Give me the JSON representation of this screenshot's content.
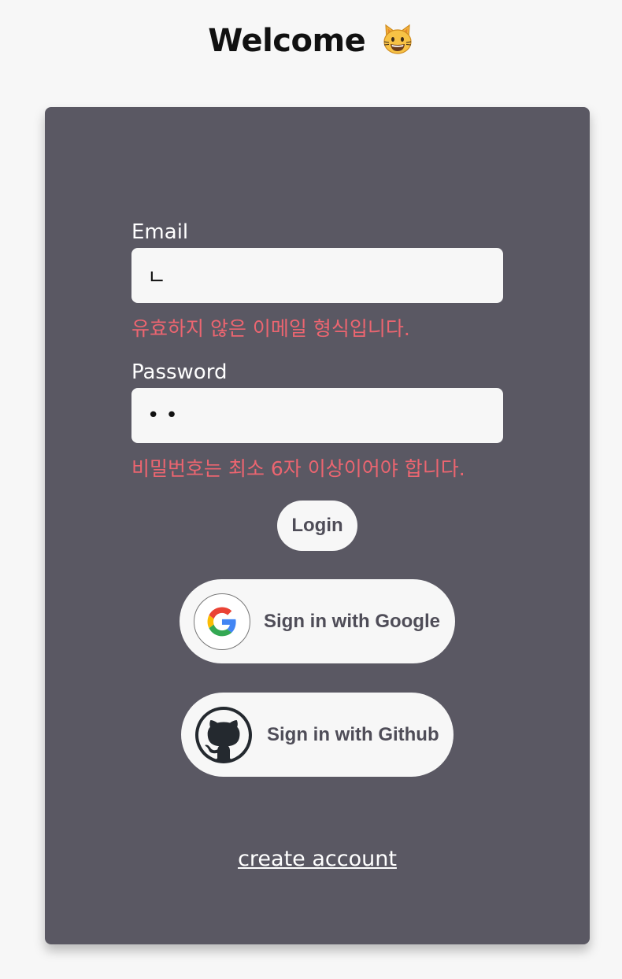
{
  "header": {
    "title": "Welcome",
    "emoji_icon": "grinning-cat-emoji"
  },
  "form": {
    "email": {
      "label": "Email",
      "value": "ㄴ",
      "error": "유효하지 않은 이메일 형식입니다."
    },
    "password": {
      "label": "Password",
      "value": "••",
      "error": "비밀번호는 최소 6자 이상이어야 합니다."
    },
    "login_label": "Login"
  },
  "social": {
    "google": {
      "label": "Sign in with Google",
      "icon": "google-logo-icon"
    },
    "github": {
      "label": "Sign in with Github",
      "icon": "github-octocat-icon"
    }
  },
  "footer": {
    "create_account_label": "create account"
  },
  "colors": {
    "page_background": "#f7f7f7",
    "card_background": "#5a5863",
    "error": "#ec6570",
    "button_text": "#4f4d58"
  }
}
